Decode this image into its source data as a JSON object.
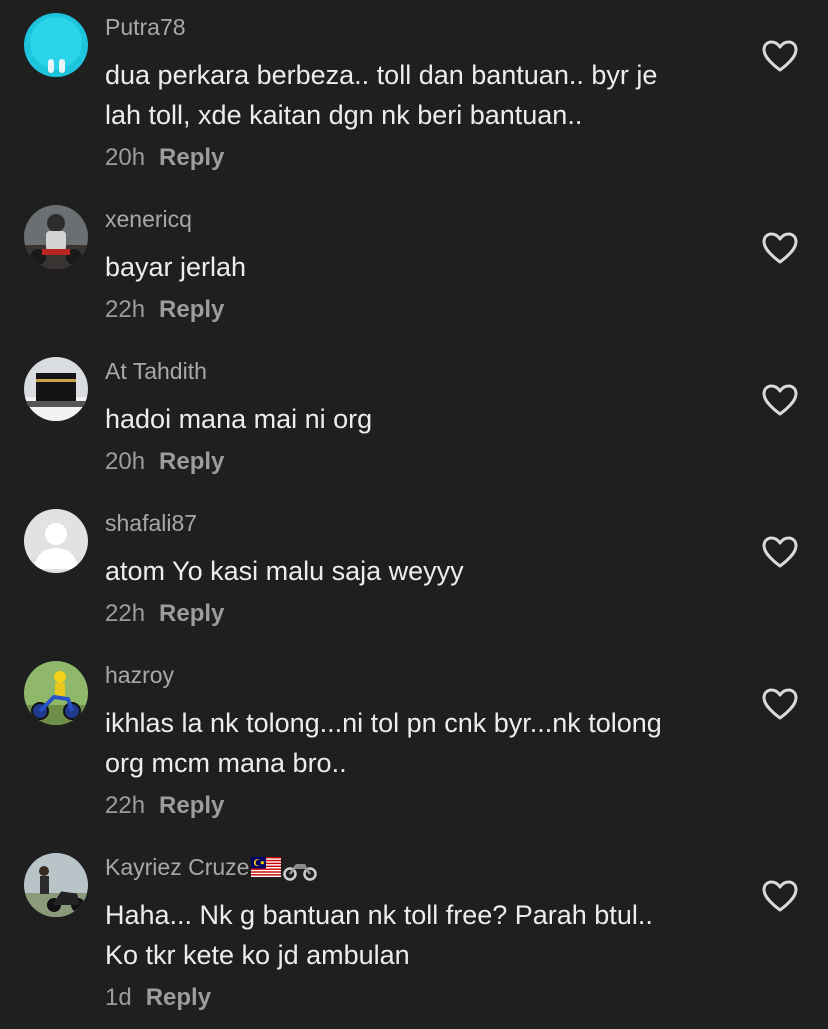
{
  "comments": [
    {
      "username": "Putra78",
      "lines": [
        "dua perkara berbeza.. toll dan bantuan.. byr je",
        "lah toll, xde kaitan dgn nk beri bantuan.."
      ],
      "time": "20h",
      "reply": "Reply"
    },
    {
      "username": "xenericq",
      "lines": [
        "bayar jerlah"
      ],
      "time": "22h",
      "reply": "Reply"
    },
    {
      "username": "At Tahdith",
      "lines": [
        "hadoi mana mai ni org"
      ],
      "time": "20h",
      "reply": "Reply"
    },
    {
      "username": "shafali87",
      "lines": [
        "atom Yo kasi malu saja weyyy"
      ],
      "time": "22h",
      "reply": "Reply"
    },
    {
      "username": "hazroy",
      "lines": [
        "ikhlas la nk tolong...ni tol pn cnk byr...nk tolong",
        "org mcm mana bro.."
      ],
      "time": "22h",
      "reply": "Reply"
    },
    {
      "username": "Kayriez Cruze",
      "lines": [
        "Haha... Nk g bantuan nk toll free? Parah btul..",
        "Ko tkr kete ko jd ambulan"
      ],
      "time": "1d",
      "reply": "Reply"
    }
  ],
  "icons": {
    "like": "heart-outline-icon",
    "flag": "malaysia-flag-emoji",
    "motorcycle": "motorcycle-emoji"
  },
  "colors": {
    "background": "#1f1f1f",
    "username": "#a8a8a8",
    "text": "#ededed",
    "meta": "#9c9c9c"
  }
}
